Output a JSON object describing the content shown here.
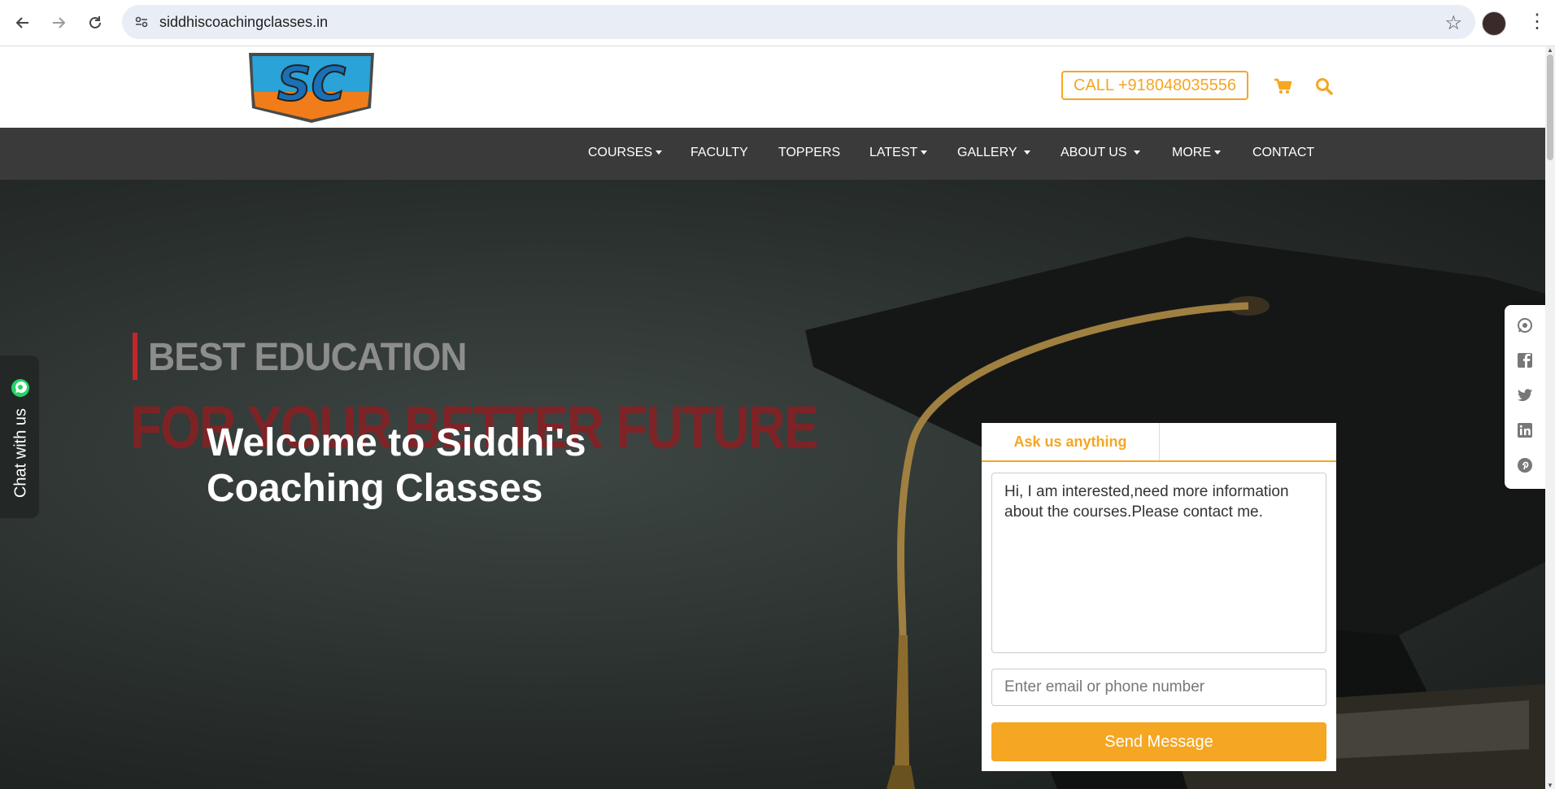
{
  "browser": {
    "url": "siddhiscoachingclasses.in",
    "back_icon": "arrow-left-icon",
    "forward_icon": "arrow-right-icon",
    "reload_icon": "reload-icon",
    "bookmark_icon": "star-icon",
    "menu_icon": "more-vert-icon"
  },
  "header": {
    "logo_text": "SC",
    "call_label": "CALL +918048035556",
    "accent_color": "#f5a623"
  },
  "nav": {
    "items": [
      {
        "label": "COURSES",
        "dropdown": true
      },
      {
        "label": "FACULTY",
        "dropdown": false
      },
      {
        "label": "TOPPERS",
        "dropdown": false
      },
      {
        "label": "LATEST",
        "dropdown": true
      },
      {
        "label": "GALLERY",
        "dropdown": true
      },
      {
        "label": "ABOUT US",
        "dropdown": true
      },
      {
        "label": "MORE",
        "dropdown": true
      },
      {
        "label": "CONTACT",
        "dropdown": false
      }
    ]
  },
  "hero": {
    "banner_line1": "BEST EDUCATION",
    "banner_line2": "FOR YOUR BETTER FUTURE",
    "welcome_title": "Welcome to Siddhi's Coaching Classes"
  },
  "chat": {
    "label": "Chat with us"
  },
  "social": [
    "whatsapp-icon",
    "facebook-icon",
    "twitter-icon",
    "linkedin-icon",
    "pinterest-icon"
  ],
  "form": {
    "tab_label": "Ask us anything",
    "message_value": "Hi, I am interested,need more information about the courses.Please contact me.",
    "contact_placeholder": "Enter email or phone number",
    "send_label": "Send Message"
  }
}
